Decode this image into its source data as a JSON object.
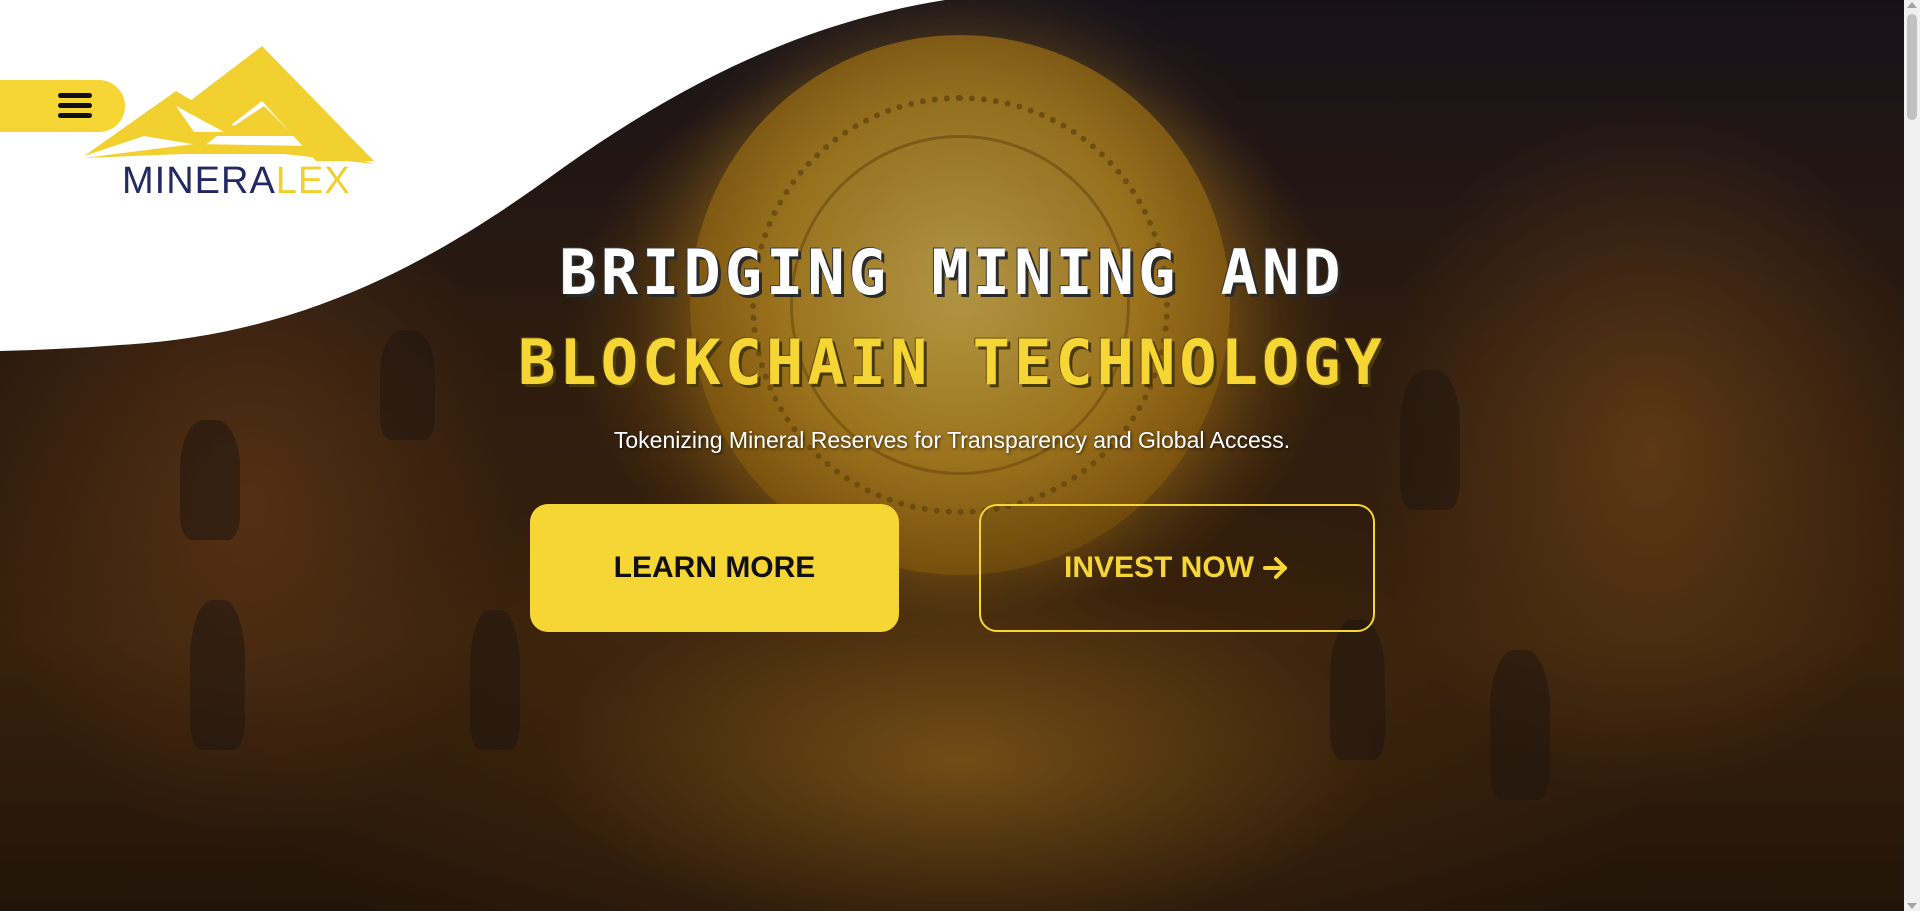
{
  "brand": {
    "logo_text_main": "MINERA",
    "logo_text_accent": "LEX",
    "accent_color": "#f6d634",
    "navy_color": "#232a63"
  },
  "nav": {
    "menu_icon": "hamburger-icon"
  },
  "hero": {
    "headline_line1": "BRIDGING MINING AND",
    "headline_line2": "BLOCKCHAIN TECHNOLOGY",
    "subheadline": "Tokenizing Mineral Reserves for Transparency and Global Access.",
    "background_image": "mining-scene-illustration",
    "buttons": {
      "learn_more_label": "LEARN MORE",
      "invest_now_label": "INVEST NOW",
      "invest_now_icon": "arrow-right-icon"
    }
  }
}
